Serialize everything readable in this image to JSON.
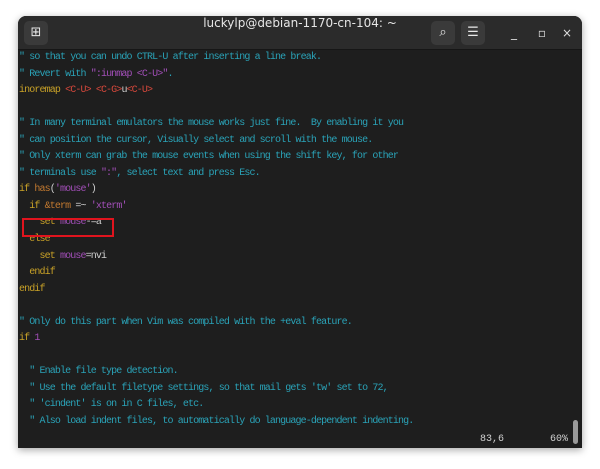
{
  "window": {
    "title": "luckylp@debian-1170-cn-104: ~",
    "new_tab_icon": "new-tab-icon",
    "search_icon": "search-icon",
    "menu_icon": "hamburger-menu-icon",
    "minimize": "_",
    "maximize": "▫",
    "close": "×"
  },
  "lines": [
    [
      [
        "c",
        "\" so that you can undo CTRL-U after inserting a line break."
      ]
    ],
    [
      [
        "c",
        "\" Revert with "
      ],
      [
        "s",
        "\":iunmap <C-U>\""
      ],
      [
        "c",
        "."
      ]
    ],
    [
      [
        "k",
        "inoremap "
      ],
      [
        "r",
        "<C-U> <C-G>"
      ],
      [
        "n",
        "u"
      ],
      [
        "r",
        "<C-U>"
      ]
    ],
    [],
    [
      [
        "c",
        "\" In many terminal emulators the mouse works just fine.  By enabling it you"
      ]
    ],
    [
      [
        "c",
        "\" can position the cursor, Visually select and scroll with the mouse."
      ]
    ],
    [
      [
        "c",
        "\" Only xterm can grab the mouse events when using the shift key, for other"
      ]
    ],
    [
      [
        "c",
        "\" terminals use "
      ],
      [
        "s",
        "\":\""
      ],
      [
        "c",
        ", select text and press Esc."
      ]
    ],
    [
      [
        "k",
        "if "
      ],
      [
        "o",
        "has"
      ],
      [
        "n",
        "("
      ],
      [
        "s",
        "'mouse'"
      ],
      [
        "n",
        ")"
      ]
    ],
    [
      [
        "k",
        "  if "
      ],
      [
        "o",
        "&term "
      ],
      [
        "n",
        "=~ "
      ],
      [
        "s",
        "'xterm'"
      ]
    ],
    [
      [
        "k",
        "    set "
      ],
      [
        "s",
        "mouse"
      ],
      [
        "n",
        "-=a"
      ]
    ],
    [
      [
        "k",
        "  else"
      ]
    ],
    [
      [
        "k",
        "    set "
      ],
      [
        "s",
        "mouse"
      ],
      [
        "n",
        "=nvi"
      ]
    ],
    [
      [
        "k",
        "  endif"
      ]
    ],
    [
      [
        "k",
        "endif"
      ]
    ],
    [],
    [
      [
        "c",
        "\" Only do this part when Vim was compiled with the +eval feature."
      ]
    ],
    [
      [
        "k",
        "if "
      ],
      [
        "s",
        "1"
      ]
    ],
    [],
    [
      [
        "c",
        "  \" Enable file type detection."
      ]
    ],
    [
      [
        "c",
        "  \" Use the default filetype settings, so that mail gets 'tw' set to 72,"
      ]
    ],
    [
      [
        "c",
        "  \" 'cindent' is on in C files, etc."
      ]
    ],
    [
      [
        "c",
        "  \" Also load indent files, to automatically do language-dependent indenting."
      ]
    ]
  ],
  "status": {
    "position": "83,6",
    "percent": "60%"
  }
}
